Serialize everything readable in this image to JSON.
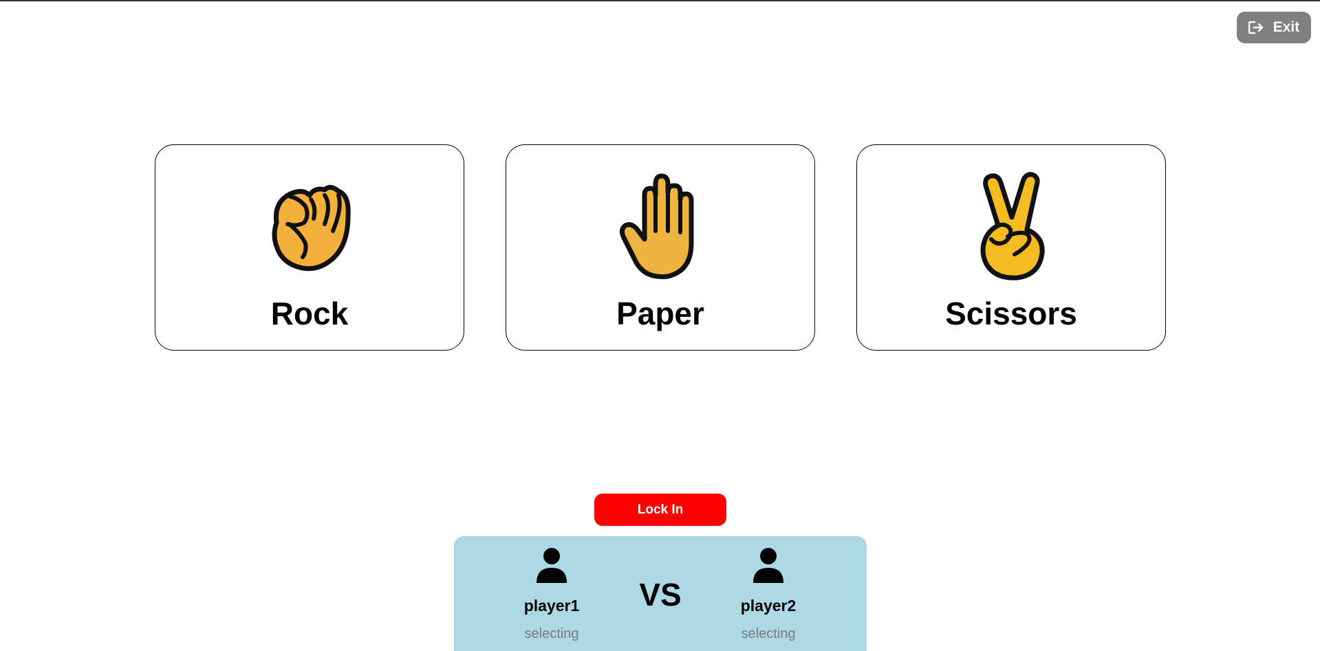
{
  "header": {
    "exit_label": "Exit",
    "exit_icon": "sign-out-icon"
  },
  "choices": [
    {
      "label": "Rock",
      "icon": "fist-icon"
    },
    {
      "label": "Paper",
      "icon": "raised-hand-icon"
    },
    {
      "label": "Scissors",
      "icon": "victory-hand-icon"
    }
  ],
  "lock_in_label": "Lock In",
  "match": {
    "vs_label": "VS",
    "player1": {
      "name": "player1",
      "status": "selecting"
    },
    "player2": {
      "name": "player2",
      "status": "selecting"
    }
  },
  "colors": {
    "exit_bg": "#808080",
    "lock_in_bg": "#ff0000",
    "panel_bg": "#add8e6",
    "hand_fill": "#f3b13b",
    "hand_fill_paper": "#efb43f",
    "hand_fill_scissors": "#f7bb22"
  }
}
